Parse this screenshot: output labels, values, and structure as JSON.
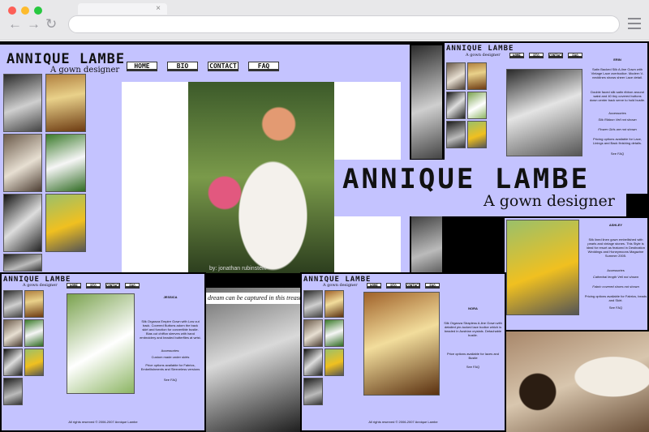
{
  "browser": {
    "tab_close": "×",
    "back": "←",
    "forward": "→",
    "reload": "↻"
  },
  "site": {
    "brand": "ANNIQUE LAMBE",
    "tagline": "A gown designer",
    "nav": [
      "HOME",
      "BIO",
      "CONTACT",
      "FAQ"
    ]
  },
  "main_page": {
    "caption": "dream can be captured in this treasured",
    "photo_credit": "by: jonathan rubinstein"
  },
  "detail_pages": {
    "erin": {
      "name": "ERIN",
      "description": "Satin Backed Silk A-line Gown with Vintage Lace overbodice. Modern V-necklines shows sheer Lace detail.",
      "detail": "Double faced silk satin ribbon around waist and 40 tiny covered buttons down center back serve to hold bustle.",
      "accessories_heading": "Accessories",
      "accessories": "Silk Ribbon Veil not shown",
      "extra": "Flower Girls are not shown",
      "pricing": "Pricing options available for Lace, Linings and Back finishing details.",
      "see_faq": "See FAQ"
    },
    "ashley": {
      "name": "ASHLEY",
      "description": "Silk lined linen gown embellished with pearls and vintage stones. This Style is ideal for resort as featured in Destination Weddings and Honeymoons Magazine Summer 2005.",
      "accessories_heading": "Accessories",
      "accessories": "Cathedral length Veil not shown",
      "extra": "Fabric covered shoes not shown",
      "pricing": "Pricing options available for Fabrics, beads and Skirt.",
      "see_faq": "See FAQ"
    },
    "jessica": {
      "name": "JESSICA",
      "description": "Silk Organza Empire Gown with Low cut back. Covered Buttons adorn the back skirt and function for convertible bustle. Bias cut chiffon sleeves with hand embroidery and beaded butterflies at wrist.",
      "accessories_heading": "Accessories:",
      "accessories": "Custom made under skirts",
      "pricing": "Price options available for Fabrics, Embellishments and Sleeveless versions",
      "see_faq": "See FAQ",
      "footer": "All rights reserved © 2006-2007 Annique Lambe"
    },
    "nora": {
      "name": "NORA",
      "description": "Silk Organza Strapless A-line Gown with detailed pin-tucked lace bodice which is beaded in Austrian crystals. Detachable bustle.",
      "pricing": "Price options available for laces and Bustle",
      "see_faq": "See FAQ",
      "footer": "All rights reserved © 2006-2007 Annique Lambe"
    }
  },
  "colors": {
    "page_bg": "#c4c3ff",
    "frame": "#000000",
    "chrome": "#e8e8ea"
  }
}
